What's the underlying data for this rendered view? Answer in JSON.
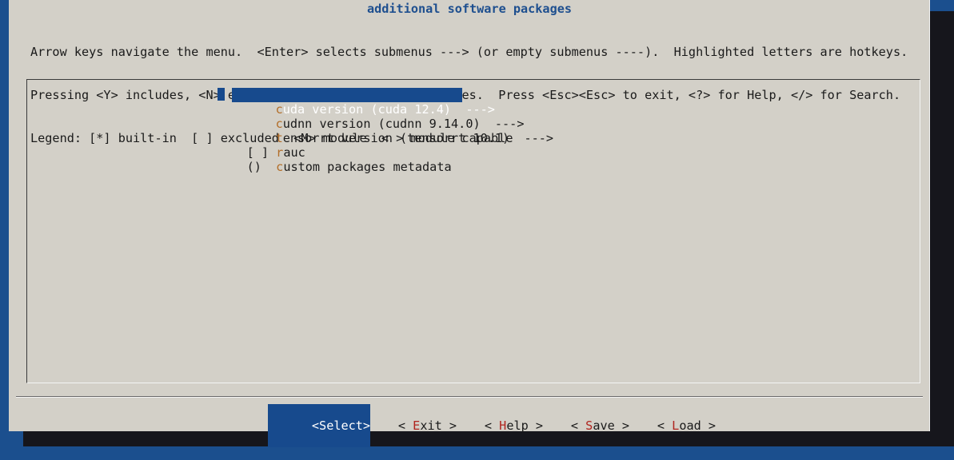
{
  "window": {
    "title": "additional software packages"
  },
  "help_text": {
    "line1": "Arrow keys navigate the menu.  <Enter> selects submenus ---> (or empty submenus ----).  Highlighted letters are hotkeys.",
    "line2": "Pressing <Y> includes, <N> excludes, <M> modularizes features.  Press <Esc><Esc> to exit, <?> for Help, </> for Search.",
    "line3": "Legend: [*] built-in  [ ] excluded  <M> module  < > module capable"
  },
  "menu": {
    "items": [
      {
        "prefix": "",
        "hotkey": "c",
        "rest": "uda version (cuda 12.4)  --->",
        "selected": true
      },
      {
        "prefix": "",
        "hotkey": "c",
        "rest": "udnn version (cudnn 9.14.0)  --->",
        "selected": false
      },
      {
        "prefix": "",
        "hotkey": "t",
        "rest": "ensorrt version (tensorrt 10.1)  --->",
        "selected": false
      },
      {
        "prefix": "[ ] ",
        "hotkey": "r",
        "rest": "auc",
        "selected": false
      },
      {
        "prefix": "()  ",
        "hotkey": "c",
        "rest": "ustom packages metadata",
        "selected": false
      }
    ]
  },
  "buttons": {
    "select": {
      "open": "<",
      "hotkey": "S",
      "rest": "elect",
      "close": ">"
    },
    "exit": {
      "open": "< ",
      "hotkey": "E",
      "rest": "xit",
      "close": " >"
    },
    "help": {
      "open": "< ",
      "hotkey": "H",
      "rest": "elp",
      "close": " >"
    },
    "save": {
      "open": "< ",
      "hotkey": "S",
      "rest": "ave",
      "close": " >"
    },
    "load": {
      "open": "< ",
      "hotkey": "L",
      "rest": "oad",
      "close": " >"
    }
  },
  "colors": {
    "background": "#1b4f8e",
    "dialog": "#d3d0c8",
    "selection": "#174a8d",
    "hotkey": "#b26d27",
    "button_hotkey": "#b0241e",
    "title": "#1e4f8f"
  }
}
